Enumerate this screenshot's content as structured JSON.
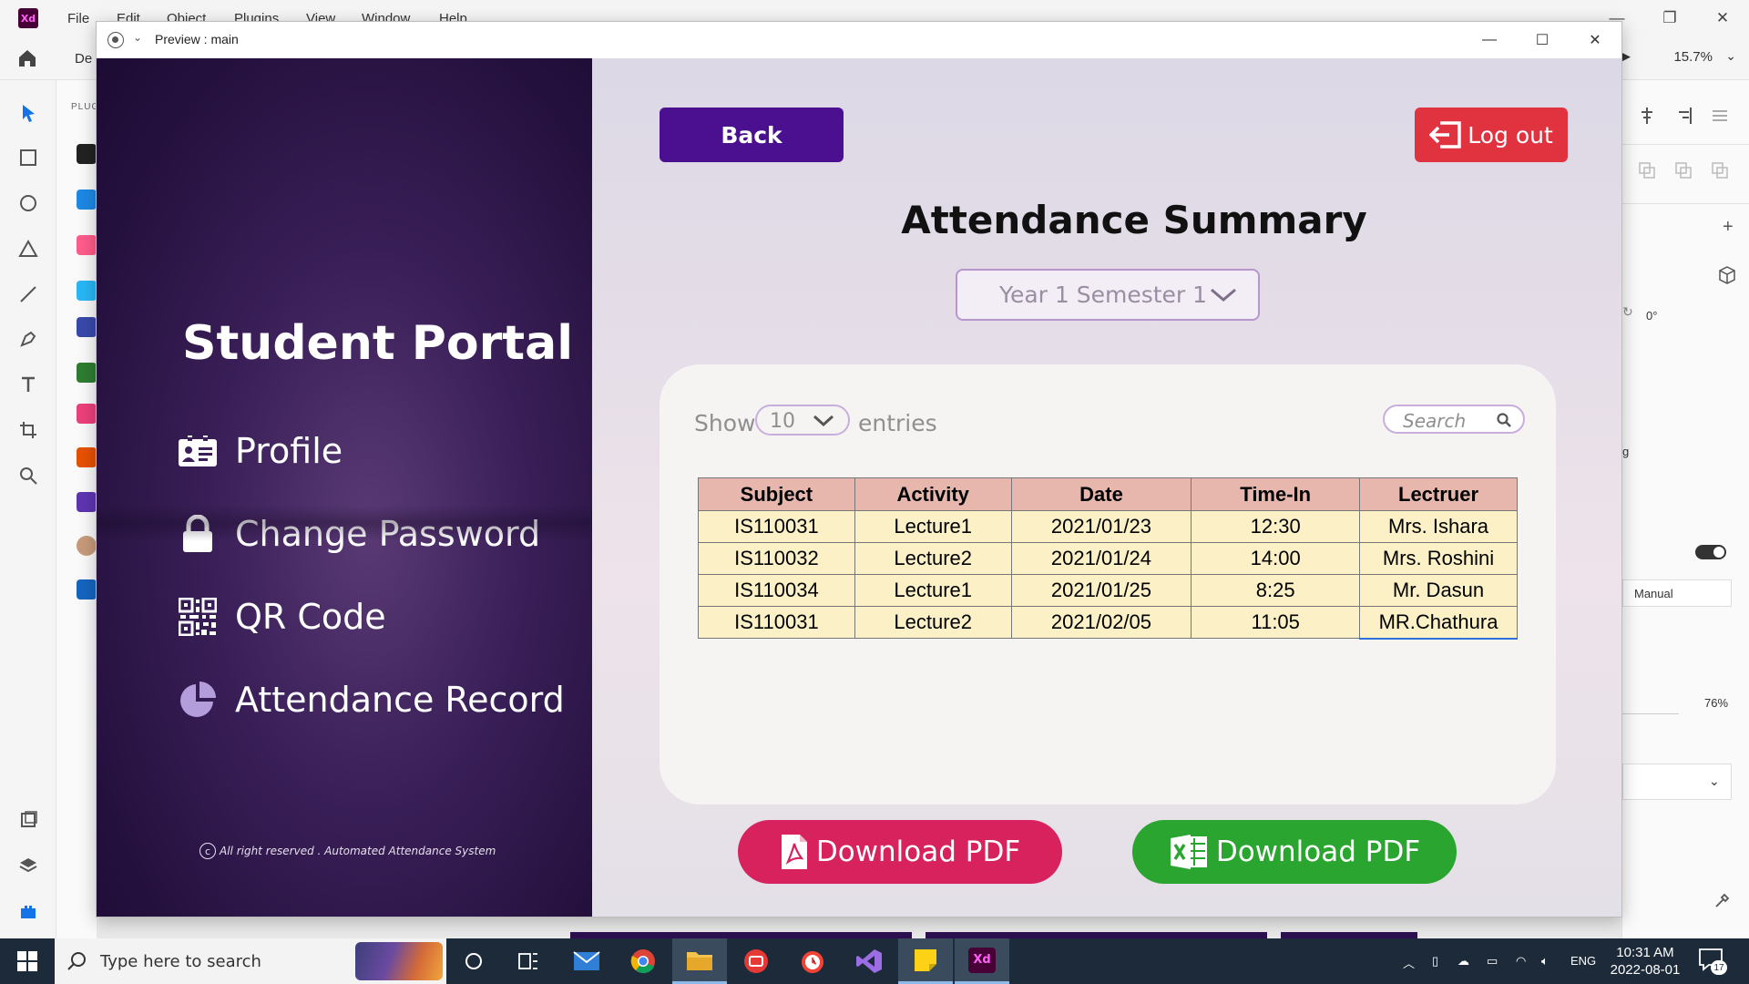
{
  "host_app": {
    "logo": "Xd",
    "menu": [
      "File",
      "Edit",
      "Object",
      "Plugins",
      "View",
      "Window",
      "Help"
    ],
    "tab_label": "De",
    "zoom": "15.7%",
    "plugins_label": "PLUG",
    "right_panel": {
      "rotation": "0°",
      "partial_label": "g",
      "mode": "Manual",
      "opacity": "76%"
    }
  },
  "preview_window": {
    "title": "Preview : main"
  },
  "sidebar": {
    "title": "Student Portal",
    "items": [
      {
        "label": "Profile",
        "icon": "profile-card-icon"
      },
      {
        "label": "Change Password",
        "icon": "lock-icon"
      },
      {
        "label": "QR Code",
        "icon": "qr-code-icon"
      },
      {
        "label": "Attendance Record",
        "icon": "pie-chart-icon"
      }
    ],
    "copyright": "All right reserved . Automated Attendance System"
  },
  "main": {
    "back_label": "Back",
    "logout_label": "Log out",
    "heading": "Attendance Summary",
    "semester_selected": "Year 1 Semester 1",
    "show_label": "Show",
    "entries_value": "10",
    "entries_label": "entries",
    "search_placeholder": "Search",
    "table": {
      "headers": [
        "Subject",
        "Activity",
        "Date",
        "Time-In",
        "Lectruer"
      ],
      "rows": [
        [
          "IS110031",
          "Lecture1",
          "2021/01/23",
          "12:30",
          "Mrs. Ishara"
        ],
        [
          "IS110032",
          "Lecture2",
          "2021/01/24",
          "14:00",
          "Mrs. Roshini"
        ],
        [
          "IS110034",
          "Lecture1",
          "2021/01/25",
          "8:25",
          "Mr.  Dasun"
        ],
        [
          "IS110031",
          "Lecture2",
          "2021/02/05",
          "11:05",
          "MR.Chathura"
        ]
      ]
    },
    "download_pdf_label": "Download PDF",
    "download_excel_label": "Download PDF",
    "colors": {
      "back": "#4a1090",
      "logout": "#e0323f",
      "pdf": "#d7225d",
      "excel": "#2aa52f",
      "table_header": "#e7b6ac",
      "table_cell": "#fbf0c6"
    }
  },
  "taskbar": {
    "search_placeholder": "Type here to search",
    "language": "ENG",
    "time": "10:31 AM",
    "date": "2022-08-01",
    "notification_count": "17"
  }
}
